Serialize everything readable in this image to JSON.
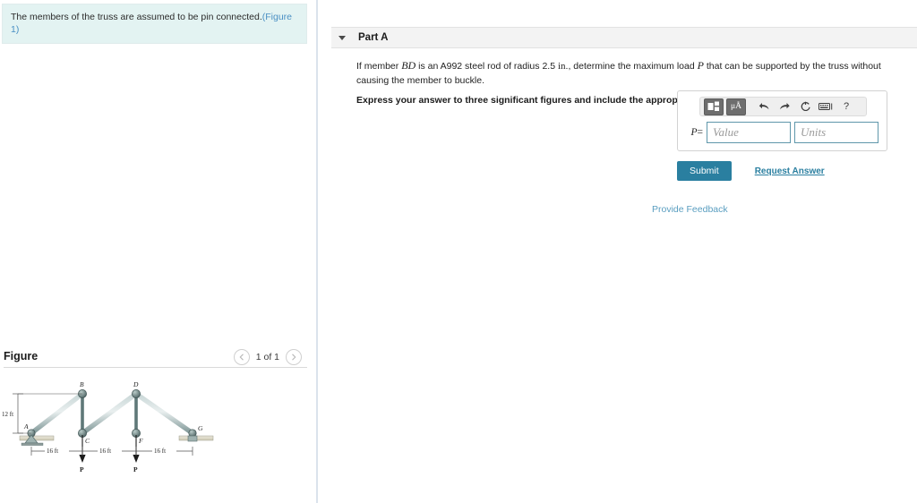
{
  "left": {
    "problem_statement": "The members of the truss are assumed to be pin connected.",
    "figure_link": "(Figure 1)",
    "figure_heading": "Figure",
    "pager": {
      "prev_icon": "chevron-left-icon",
      "next_icon": "chevron-right-icon",
      "count_label": "1 of 1"
    }
  },
  "right": {
    "part": {
      "caret_icon": "caret-down-icon",
      "label": "Part A"
    },
    "question": {
      "pre_member": "If member ",
      "member": "BD",
      "mid1": " is an A992 steel rod of radius 2.5 ",
      "unit": "in",
      "mid2": "., determine the maximum load ",
      "load_symbol": "P",
      "tail": " that can be supported by the truss without causing the member to buckle.",
      "instruction": "Express your answer to three significant figures and include the appropriate units."
    },
    "answer": {
      "toolbar": [
        {
          "name": "math-template-icon",
          "glyph": "template"
        },
        {
          "name": "units-icon",
          "glyph": "μÅ"
        },
        {
          "name": "undo-icon",
          "glyph": "⮤"
        },
        {
          "name": "redo-icon",
          "glyph": "⮥"
        },
        {
          "name": "reset-icon",
          "glyph": "↺"
        },
        {
          "name": "keyboard-icon",
          "glyph": "⌨"
        },
        {
          "name": "help-icon",
          "glyph": "?"
        }
      ],
      "variable_label": "P",
      "equals": "=",
      "value_placeholder": "Value",
      "units_placeholder": "Units"
    },
    "actions": {
      "submit_label": "Submit",
      "request_answer_label": "Request Answer",
      "provide_feedback_label": "Provide Feedback"
    }
  },
  "figure_diagram": {
    "type": "engineering-truss",
    "joints": [
      "A",
      "B",
      "C",
      "D",
      "F",
      "G"
    ],
    "height_label": "12 ft",
    "span_labels": [
      "16 ft",
      "16 ft",
      "16 ft"
    ],
    "load_labels": [
      "P",
      "P"
    ],
    "supports": [
      "pin",
      "roller"
    ]
  },
  "colors": {
    "banner_bg": "#e3f3f2",
    "link_blue": "#4a90c4",
    "accent_teal": "#2a7fa0",
    "input_border": "#5f97ab",
    "divider": "#dbe3ec",
    "part_header_bg": "#f3f3f3",
    "truss_steel": "#8fa6a6",
    "truss_dark": "#4e6464"
  }
}
